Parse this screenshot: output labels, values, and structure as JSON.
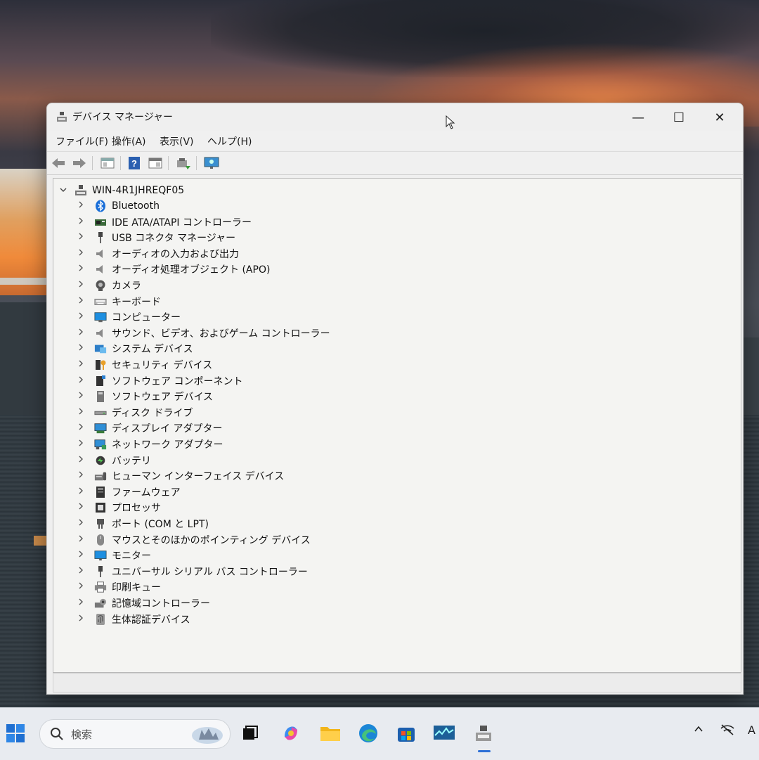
{
  "window": {
    "title": "デバイス マネージャー",
    "controls": {
      "minimize": "—",
      "maximize": "☐",
      "close": "✕"
    }
  },
  "menu": [
    "ファイル(F)",
    "操作(A)",
    "表示(V)",
    "ヘルプ(H)"
  ],
  "toolbar": [
    "back-icon",
    "forward-icon",
    "properties-icon",
    "help-icon",
    "view-icon",
    "update-driver-icon",
    "scan-hardware-icon"
  ],
  "tree": {
    "root": "WIN-4R1JHREQF05",
    "items": [
      {
        "label": "Bluetooth",
        "icon": "bluetooth-icon"
      },
      {
        "label": "IDE ATA/ATAPI コントローラー",
        "icon": "ide-controller-icon"
      },
      {
        "label": "USB コネクタ マネージャー",
        "icon": "usb-connector-icon"
      },
      {
        "label": "オーディオの入力および出力",
        "icon": "speaker-icon"
      },
      {
        "label": "オーディオ処理オブジェクト (APO)",
        "icon": "speaker-icon"
      },
      {
        "label": "カメラ",
        "icon": "camera-icon"
      },
      {
        "label": "キーボード",
        "icon": "keyboard-icon"
      },
      {
        "label": "コンピューター",
        "icon": "computer-icon"
      },
      {
        "label": "サウンド、ビデオ、およびゲーム コントローラー",
        "icon": "speaker-icon"
      },
      {
        "label": "システム デバイス",
        "icon": "system-device-icon"
      },
      {
        "label": "セキュリティ デバイス",
        "icon": "security-device-icon"
      },
      {
        "label": "ソフトウェア コンポーネント",
        "icon": "software-component-icon"
      },
      {
        "label": "ソフトウェア デバイス",
        "icon": "software-device-icon"
      },
      {
        "label": "ディスク ドライブ",
        "icon": "disk-drive-icon"
      },
      {
        "label": "ディスプレイ アダプター",
        "icon": "display-adapter-icon"
      },
      {
        "label": "ネットワーク アダプター",
        "icon": "network-adapter-icon"
      },
      {
        "label": "バッテリ",
        "icon": "battery-icon"
      },
      {
        "label": "ヒューマン インターフェイス デバイス",
        "icon": "hid-icon"
      },
      {
        "label": "ファームウェア",
        "icon": "firmware-icon"
      },
      {
        "label": "プロセッサ",
        "icon": "processor-icon"
      },
      {
        "label": "ポート (COM と LPT)",
        "icon": "port-icon"
      },
      {
        "label": "マウスとそのほかのポインティング デバイス",
        "icon": "mouse-icon"
      },
      {
        "label": "モニター",
        "icon": "monitor-icon"
      },
      {
        "label": "ユニバーサル シリアル バス コントローラー",
        "icon": "usb-icon"
      },
      {
        "label": "印刷キュー",
        "icon": "printer-icon"
      },
      {
        "label": "記憶域コントローラー",
        "icon": "storage-controller-icon"
      },
      {
        "label": "生体認証デバイス",
        "icon": "biometric-icon"
      }
    ]
  },
  "taskbar": {
    "search_placeholder": "検索",
    "apps": [
      "start-icon",
      "task-view-icon",
      "copilot-icon",
      "file-explorer-icon",
      "edge-icon",
      "store-icon",
      "performance-monitor-icon",
      "device-manager-icon"
    ],
    "tray": [
      "chevron-up-icon",
      "network-off-icon",
      "ime-icon"
    ],
    "ime_label": "A"
  }
}
